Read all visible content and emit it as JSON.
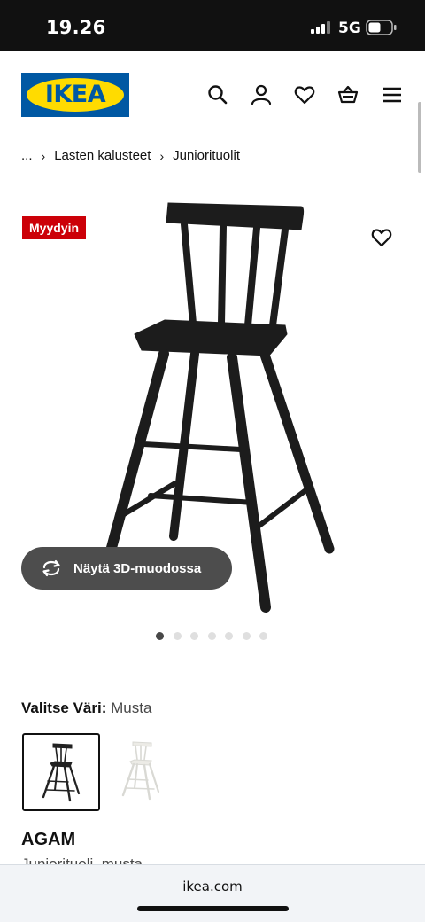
{
  "status_bar": {
    "time": "19.26",
    "network": "5G"
  },
  "header": {
    "logo_text": "IKEA"
  },
  "breadcrumb": {
    "ellipsis": "...",
    "item1": "Lasten kalusteet",
    "item2": "Juniorituolit"
  },
  "product": {
    "badge": "Myydyin",
    "view_3d_label": "Näytä 3D-muodossa",
    "image_count": 7,
    "active_image": 1,
    "color_label": "Valitse Väri:",
    "color_value": "Musta",
    "name": "AGAM",
    "description": "Juniorituoli, musta"
  },
  "browser": {
    "url": "ikea.com"
  },
  "colors": {
    "brand_blue": "#0058a3",
    "brand_yellow": "#ffdb00",
    "badge_red": "#cc0008"
  }
}
